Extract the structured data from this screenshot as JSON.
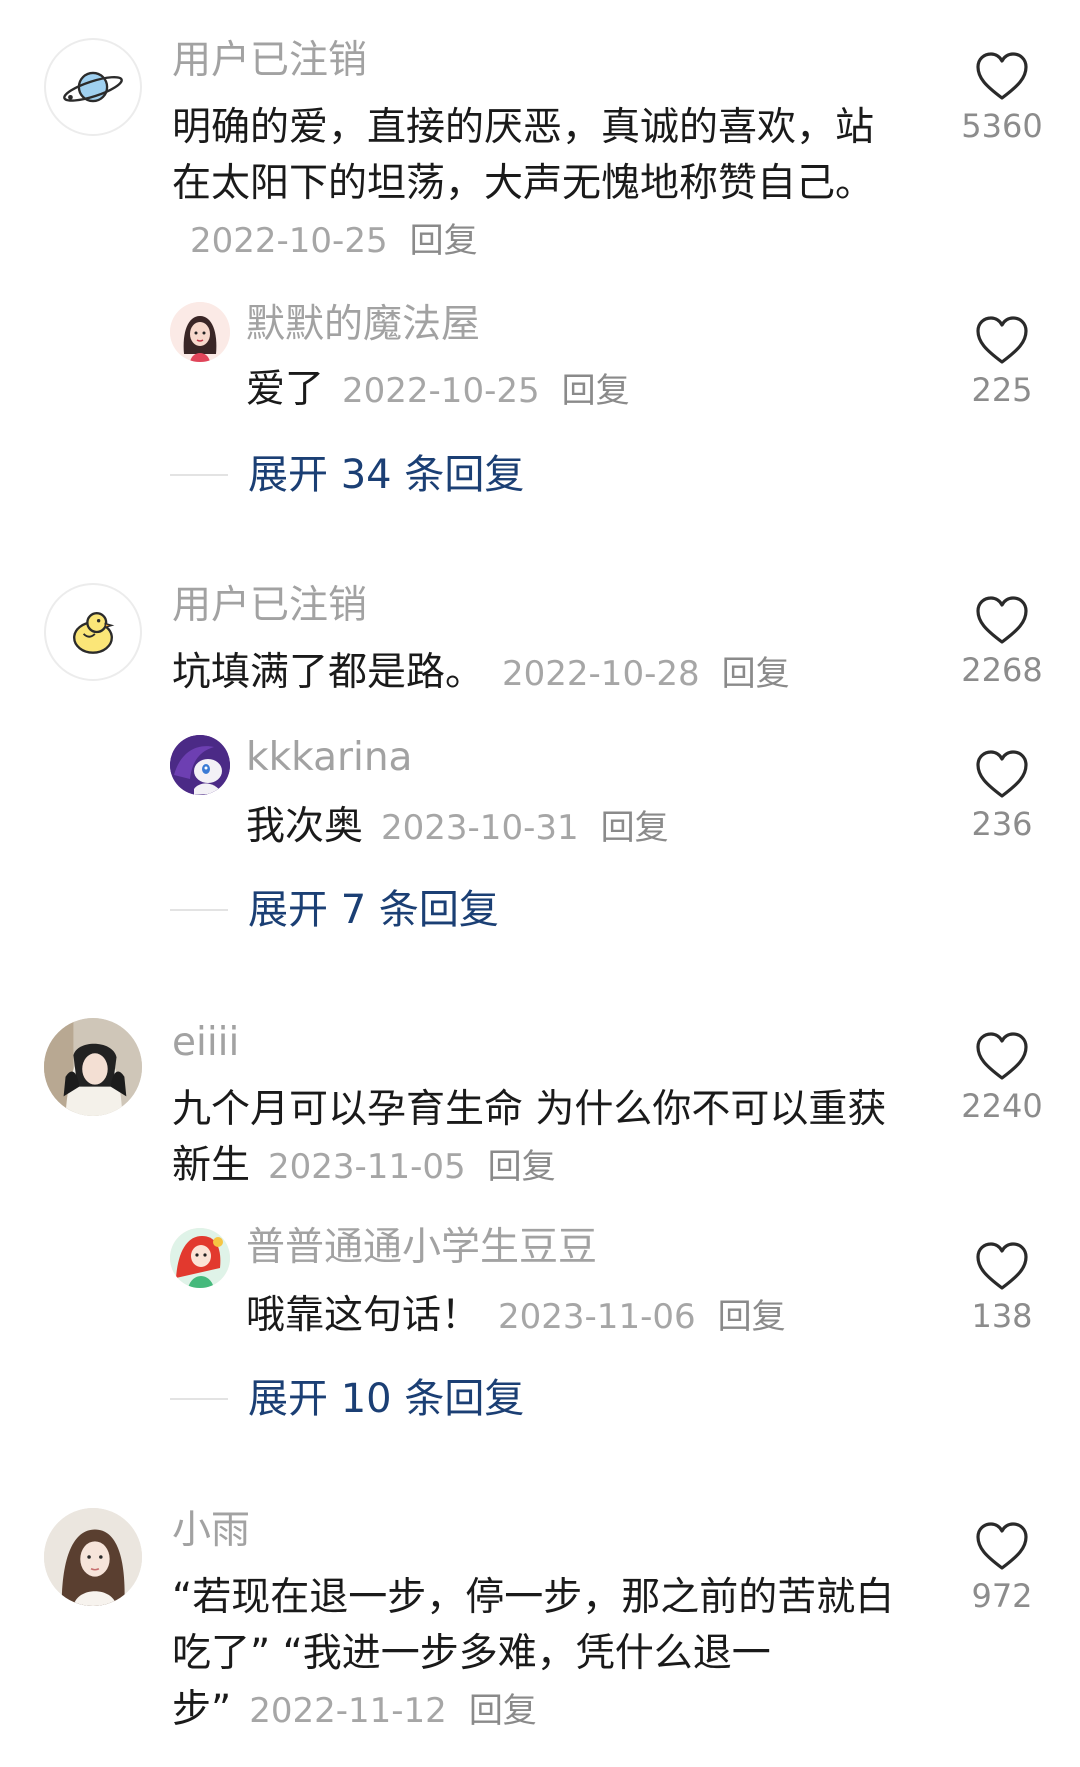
{
  "colors": {
    "username": "#a2a2a2",
    "meta": "#a6a6a6",
    "expand": "#1b3f74",
    "like_count": "#8c8c8c"
  },
  "comments": [
    {
      "username": "用户已注销",
      "avatar_icon": "planet-icon",
      "text": "明确的爱，直接的厌恶，真诚的喜欢，站在太阳下的坦荡，大声无愧地称赞自己。",
      "date": "2022-10-25",
      "reply_label": "回复",
      "likes": "5360",
      "sub_reply": {
        "username": "默默的魔法屋",
        "avatar_icon": "girl-avatar-icon",
        "text": "爱了",
        "date": "2022-10-25",
        "reply_label": "回复",
        "likes": "225"
      },
      "expand_label": "展开 34 条回复"
    },
    {
      "username": "用户已注销",
      "avatar_icon": "chick-icon",
      "text": "坑填满了都是路。",
      "date": "2022-10-28",
      "reply_label": "回复",
      "likes": "2268",
      "sub_reply": {
        "username": "kkkarina",
        "avatar_icon": "pony-avatar-icon",
        "text": "我次奥",
        "date": "2023-10-31",
        "reply_label": "回复",
        "likes": "236"
      },
      "expand_label": "展开 7 条回复"
    },
    {
      "username": "eiiii",
      "avatar_icon": "photo-avatar-icon",
      "text": "九个月可以孕育生命 为什么你不可以重获新生",
      "date": "2023-11-05",
      "reply_label": "回复",
      "likes": "2240",
      "sub_reply": {
        "username": "普普通通小学生豆豆",
        "avatar_icon": "mermaid-avatar-icon",
        "text": "哦靠这句话！",
        "date": "2023-11-06",
        "reply_label": "回复",
        "likes": "138"
      },
      "expand_label": "展开 10 条回复"
    },
    {
      "username": "小雨",
      "avatar_icon": "portrait-avatar-icon",
      "text": "“若现在退一步，停一步，那之前的苦就白吃了” “我进一步多难，凭什么退一步”",
      "date": "2022-11-12",
      "reply_label": "回复",
      "likes": "972"
    }
  ]
}
